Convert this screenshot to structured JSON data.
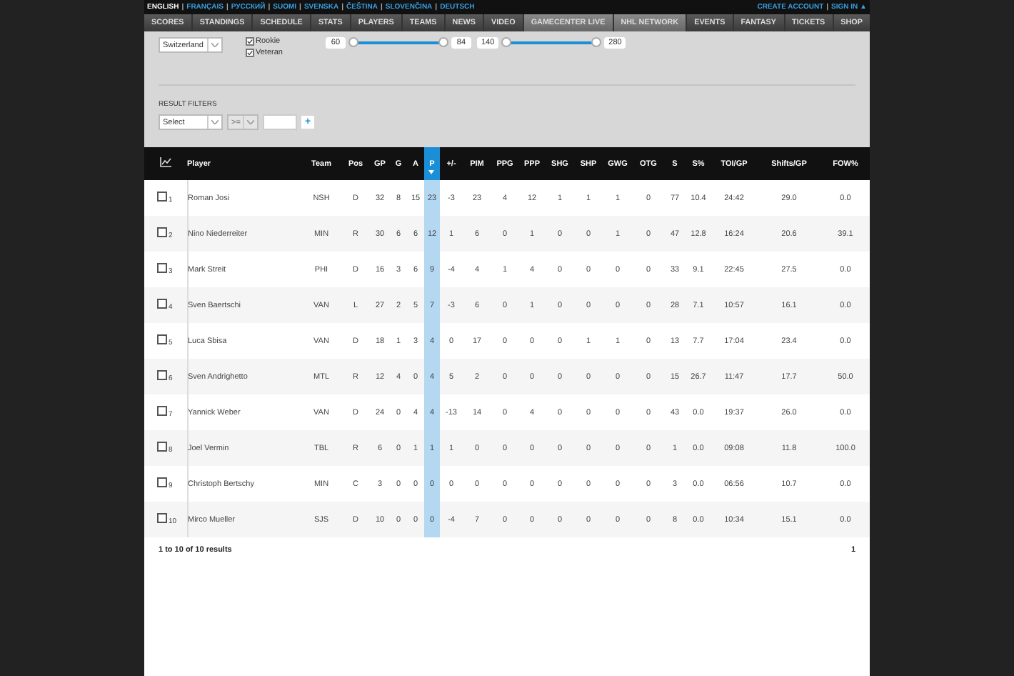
{
  "languages": [
    {
      "label": "ENGLISH",
      "selected": true
    },
    {
      "label": "FRANÇAIS",
      "selected": false
    },
    {
      "label": "РУССКИЙ",
      "selected": false
    },
    {
      "label": "SUOMI",
      "selected": false
    },
    {
      "label": "SVENSKA",
      "selected": false
    },
    {
      "label": "ČEŠTINA",
      "selected": false
    },
    {
      "label": "SLOVENČINA",
      "selected": false
    },
    {
      "label": "DEUTSCH",
      "selected": false
    }
  ],
  "separator": "|",
  "account": {
    "create": "CREATE ACCOUNT",
    "sign_in": "SIGN IN ▲"
  },
  "nav": [
    {
      "label": "SCORES",
      "featured": false
    },
    {
      "label": "STANDINGS",
      "featured": false
    },
    {
      "label": "SCHEDULE",
      "featured": false
    },
    {
      "label": "STATS",
      "featured": false
    },
    {
      "label": "PLAYERS",
      "featured": false
    },
    {
      "label": "TEAMS",
      "featured": false
    },
    {
      "label": "NEWS",
      "featured": false
    },
    {
      "label": "VIDEO",
      "featured": false
    },
    {
      "label": "GAMECENTER LIVE",
      "featured": true
    },
    {
      "label": "NHL NETWORK",
      "featured": true
    },
    {
      "label": "EVENTS",
      "featured": false
    },
    {
      "label": "FANTASY",
      "featured": false
    },
    {
      "label": "TICKETS",
      "featured": false
    },
    {
      "label": "SHOP",
      "featured": false
    }
  ],
  "filters": {
    "country": "Switzerland",
    "checkboxes": [
      {
        "label": "Rookie",
        "checked": true
      },
      {
        "label": "Veteran",
        "checked": true
      }
    ],
    "sliders": [
      {
        "min": "60",
        "max": "84",
        "level": 1
      },
      {
        "min": "140",
        "max": "280",
        "level": 1
      }
    ],
    "result_filters_label": "RESULT FILTERS",
    "select": "Select",
    "operator": ">=",
    "add": "+"
  },
  "table": {
    "columns": [
      {
        "label": "Player",
        "sorted": false
      },
      {
        "label": "Team",
        "sorted": false
      },
      {
        "label": "Pos",
        "sorted": false
      },
      {
        "label": "GP",
        "sorted": false
      },
      {
        "label": "G",
        "sorted": false
      },
      {
        "label": "A",
        "sorted": false
      },
      {
        "label": "P",
        "sorted": true
      },
      {
        "label": "+/-",
        "sorted": false
      },
      {
        "label": "PIM",
        "sorted": false
      },
      {
        "label": "PPG",
        "sorted": false
      },
      {
        "label": "PPP",
        "sorted": false
      },
      {
        "label": "SHG",
        "sorted": false
      },
      {
        "label": "SHP",
        "sorted": false
      },
      {
        "label": "GWG",
        "sorted": false
      },
      {
        "label": "OTG",
        "sorted": false
      },
      {
        "label": "S",
        "sorted": false
      },
      {
        "label": "S%",
        "sorted": false
      },
      {
        "label": "TOI/GP",
        "sorted": false
      },
      {
        "label": "Shifts/GP",
        "sorted": false
      },
      {
        "label": "FOW%",
        "sorted": false
      }
    ],
    "rows": [
      {
        "rank": "1",
        "checked": false,
        "cells": [
          "Roman Josi",
          "NSH",
          "D",
          "32",
          "8",
          "15",
          "23",
          "-3",
          "23",
          "4",
          "12",
          "1",
          "1",
          "1",
          "0",
          "77",
          "10.4",
          "24:42",
          "29.0",
          "0.0"
        ]
      },
      {
        "rank": "2",
        "checked": false,
        "cells": [
          "Nino Niederreiter",
          "MIN",
          "R",
          "30",
          "6",
          "6",
          "12",
          "1",
          "6",
          "0",
          "1",
          "0",
          "0",
          "1",
          "0",
          "47",
          "12.8",
          "16:24",
          "20.6",
          "39.1"
        ]
      },
      {
        "rank": "3",
        "checked": false,
        "cells": [
          "Mark Streit",
          "PHI",
          "D",
          "16",
          "3",
          "6",
          "9",
          "-4",
          "4",
          "1",
          "4",
          "0",
          "0",
          "0",
          "0",
          "33",
          "9.1",
          "22:45",
          "27.5",
          "0.0"
        ]
      },
      {
        "rank": "4",
        "checked": false,
        "cells": [
          "Sven Baertschi",
          "VAN",
          "L",
          "27",
          "2",
          "5",
          "7",
          "-3",
          "6",
          "0",
          "1",
          "0",
          "0",
          "0",
          "0",
          "28",
          "7.1",
          "10:57",
          "16.1",
          "0.0"
        ]
      },
      {
        "rank": "5",
        "checked": false,
        "cells": [
          "Luca Sbisa",
          "VAN",
          "D",
          "18",
          "1",
          "3",
          "4",
          "0",
          "17",
          "0",
          "0",
          "0",
          "1",
          "1",
          "0",
          "13",
          "7.7",
          "17:04",
          "23.4",
          "0.0"
        ]
      },
      {
        "rank": "6",
        "checked": false,
        "cells": [
          "Sven Andrighetto",
          "MTL",
          "R",
          "12",
          "4",
          "0",
          "4",
          "5",
          "2",
          "0",
          "0",
          "0",
          "0",
          "0",
          "0",
          "15",
          "26.7",
          "11:47",
          "17.7",
          "50.0"
        ]
      },
      {
        "rank": "7",
        "checked": false,
        "cells": [
          "Yannick Weber",
          "VAN",
          "D",
          "24",
          "0",
          "4",
          "4",
          "-13",
          "14",
          "0",
          "4",
          "0",
          "0",
          "0",
          "0",
          "43",
          "0.0",
          "19:37",
          "26.0",
          "0.0"
        ]
      },
      {
        "rank": "8",
        "checked": false,
        "cells": [
          "Joel Vermin",
          "TBL",
          "R",
          "6",
          "0",
          "1",
          "1",
          "1",
          "0",
          "0",
          "0",
          "0",
          "0",
          "0",
          "0",
          "1",
          "0.0",
          "09:08",
          "11.8",
          "100.0"
        ]
      },
      {
        "rank": "9",
        "checked": false,
        "cells": [
          "Christoph Bertschy",
          "MIN",
          "C",
          "3",
          "0",
          "0",
          "0",
          "0",
          "0",
          "0",
          "0",
          "0",
          "0",
          "0",
          "0",
          "3",
          "0.0",
          "06:56",
          "10.7",
          "0.0"
        ]
      },
      {
        "rank": "10",
        "checked": false,
        "cells": [
          "Mirco Mueller",
          "SJS",
          "D",
          "10",
          "0",
          "0",
          "0",
          "-4",
          "7",
          "0",
          "0",
          "0",
          "0",
          "0",
          "0",
          "8",
          "0.0",
          "10:34",
          "15.1",
          "0.0"
        ]
      }
    ]
  },
  "footer": {
    "summary": "1 to 10 of 10 results",
    "page": "1"
  }
}
